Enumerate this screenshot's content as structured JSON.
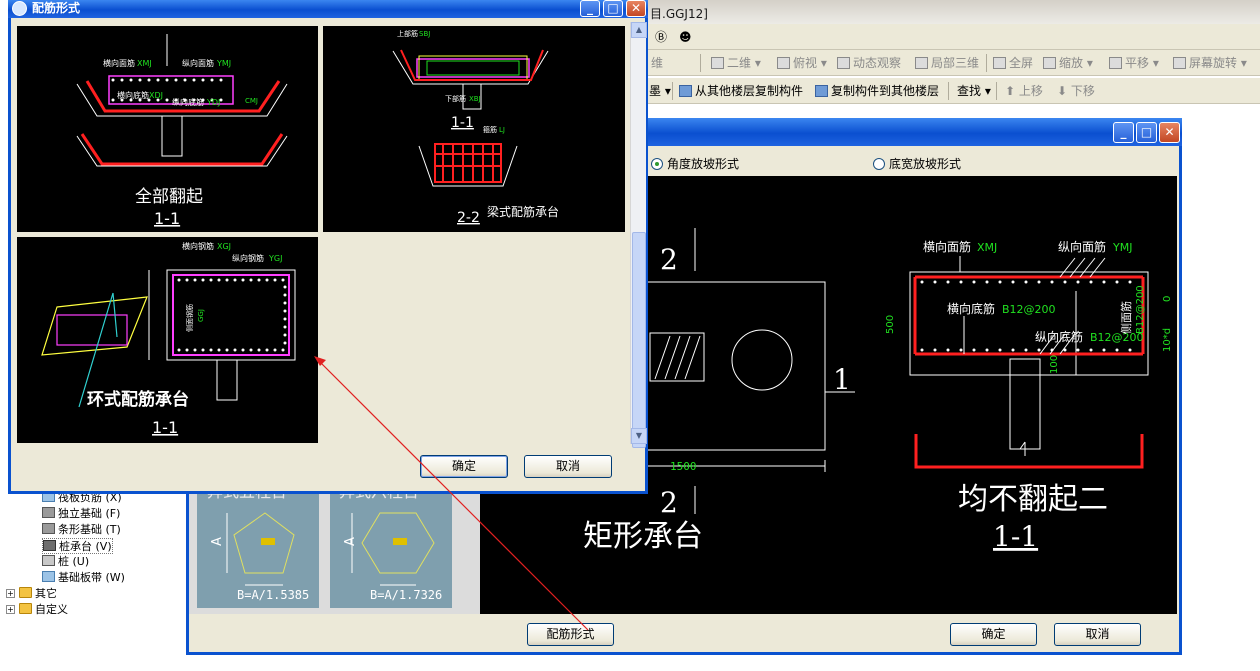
{
  "colors": {
    "xp_blue": "#0a52cf",
    "cad_black": "#000000",
    "red": "#ff2020",
    "green": "#20e020",
    "magenta": "#ff40ff",
    "yellow": "#ffff40"
  },
  "app": {
    "title_fragment": "目.GGJ12]",
    "toolbar1": {
      "items": [
        "二维",
        "俯视",
        "动态观察",
        "局部三维",
        "全屏",
        "缩放",
        "平移",
        "屏幕旋转"
      ],
      "first": "维"
    },
    "toolbar2": {
      "copy_from": "从其他楼层复制构件",
      "copy_to": "复制构件到其他楼层",
      "find": "查找",
      "move_up": "上移",
      "move_down": "下移"
    }
  },
  "tree": [
    {
      "label": "筏板负筋 (X)",
      "icon": "raft-rebar-icon"
    },
    {
      "label": "独立基础 (F)",
      "icon": "isolated-footing-icon"
    },
    {
      "label": "条形基础 (T)",
      "icon": "strip-footing-icon"
    },
    {
      "label": "桩承台 (V)",
      "icon": "pile-cap-icon"
    },
    {
      "label": "桩 (U)",
      "icon": "pile-icon"
    },
    {
      "label": "基础板带 (W)",
      "icon": "foundation-strip-icon"
    },
    {
      "label": "其它",
      "icon": "folder-icon"
    },
    {
      "label": "自定义",
      "icon": "folder-icon"
    }
  ],
  "main_dialog": {
    "radio_angle": "角度放坡形式",
    "radio_width": "底宽放坡形式",
    "thumb_texts": [
      "异式五柱台",
      "异式六柱台"
    ],
    "pent_label": "B=A/1.5385",
    "hex_label": "B=A/1.7326",
    "axis_a": "A",
    "plan": {
      "mark_2": "2",
      "mark_1": "1",
      "dim": "1500",
      "title": "矩形承台"
    },
    "section": {
      "xmj": "横向面筋",
      "xmj_code": "XMJ",
      "ymj": "纵向面筋",
      "ymj_code": "YMJ",
      "xdj": "横向底筋",
      "xdj_code": "B12@200",
      "ydj": "纵向底筋",
      "ydj_code": "B12@200",
      "side": "侧面筋",
      "side_code": "B12@200",
      "dim_500": "500",
      "dim_0": "0",
      "dim_10d": "10*d",
      "dim_100": "100",
      "title": "均不翻起二",
      "sub": "1-1"
    },
    "btn_peijin": "配筋形式",
    "btn_ok": "确定",
    "btn_cancel": "取消"
  },
  "front_dialog": {
    "title": "配筋形式",
    "cell1": {
      "top_label": "横向面筋",
      "top_code": "XMJ",
      "ymj_label": "纵向面筋",
      "ymj_code": "YMJ",
      "xdj_label": "横向底筋",
      "xdj_code": "XDJ",
      "ydj_label": "纵向底筋",
      "ydj_code": "YDJ",
      "cmj": "CMJ",
      "title": "全部翻起",
      "sub": "1-1"
    },
    "cell2": {
      "top_label": "上部筋",
      "top_code": "SBJ",
      "bottom_label": "下部筋",
      "bottom_code": "XBJ",
      "title": "梁式配筋承台",
      "sub_a": "1-1",
      "sub_b": "2-2",
      "hoop_label": "箍筋",
      "hoop_code": "LJ"
    },
    "cell3": {
      "xgj_label": "横向钢筋",
      "xgj_code": "XGJ",
      "ygj_label": "纵向钢筋",
      "ygj_code": "YGJ",
      "side_label": "侧面钢筋",
      "side_code": "GGJ",
      "title": "环式配筋承台",
      "sub": "1-1"
    },
    "btn_ok": "确定",
    "btn_cancel": "取消"
  }
}
